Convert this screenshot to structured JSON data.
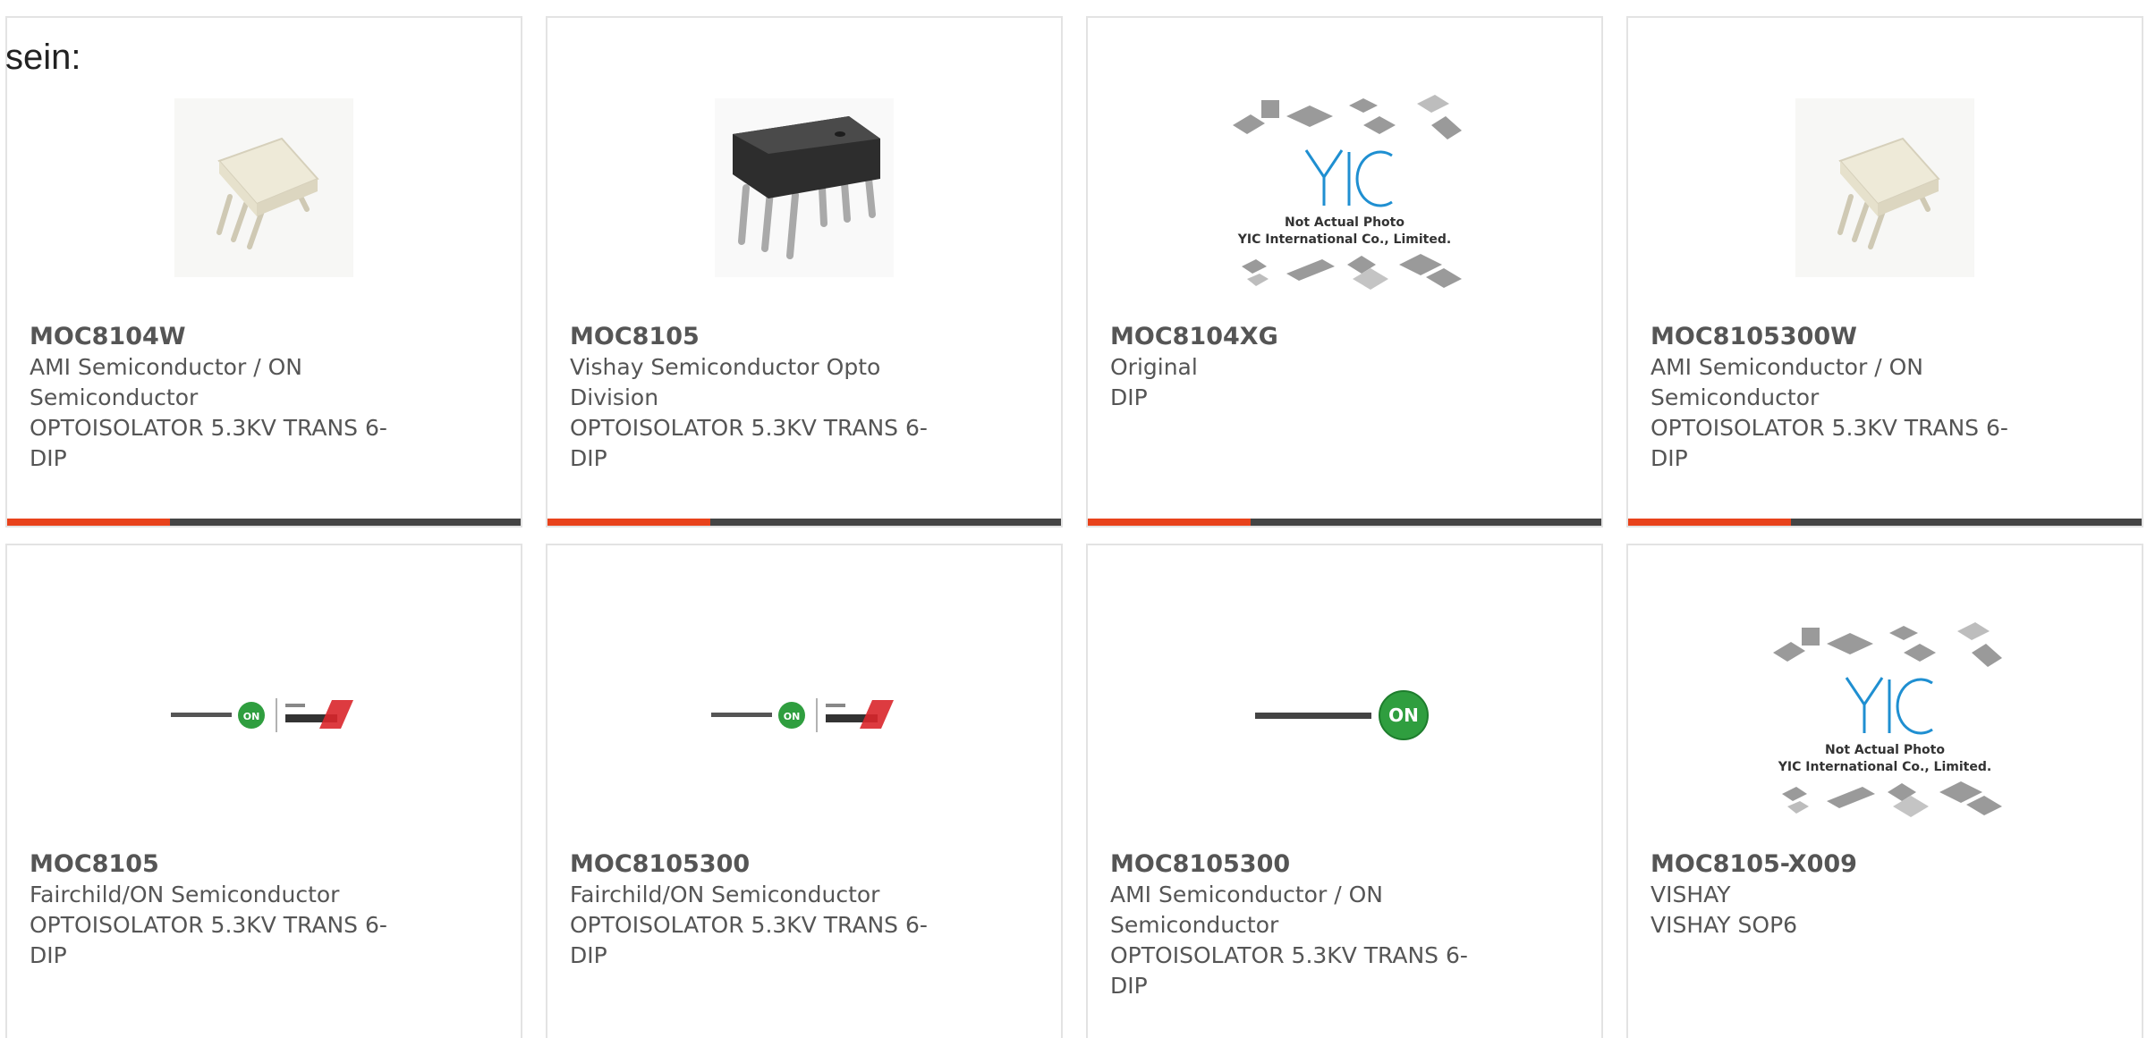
{
  "lead_text": "sein:",
  "colors": {
    "accent": "#e8421b",
    "bar": "#444444",
    "border": "#e3e3e3",
    "text": "#555555"
  },
  "cards": [
    {
      "part_number": "MOC8104W",
      "lines": [
        "AMI Semiconductor / ON",
        "Semiconductor",
        "OPTOISOLATOR 5.3KV TRANS 6-",
        "DIP"
      ],
      "image": "white-dip-optocoupler"
    },
    {
      "part_number": "MOC8105",
      "lines": [
        "Vishay Semiconductor Opto",
        "Division",
        "OPTOISOLATOR 5.3KV TRANS 6-",
        "DIP"
      ],
      "image": "black-dip-optocoupler"
    },
    {
      "part_number": "MOC8104XG",
      "lines": [
        "Original",
        "DIP"
      ],
      "image": "yic-placeholder",
      "placeholder_lines": [
        "Not Actual Photo",
        "YIC International Co., Limited."
      ]
    },
    {
      "part_number": "MOC8105300W",
      "lines": [
        "AMI Semiconductor / ON",
        "Semiconductor",
        "OPTOISOLATOR 5.3KV TRANS 6-",
        "DIP"
      ],
      "image": "white-dip-optocoupler"
    },
    {
      "part_number": "MOC8105",
      "lines": [
        "Fairchild/ON Semiconductor",
        "OPTOISOLATOR 5.3KV TRANS 6-",
        "DIP"
      ],
      "image": "on-fairchild-logo"
    },
    {
      "part_number": "MOC8105300",
      "lines": [
        "Fairchild/ON Semiconductor",
        "OPTOISOLATOR 5.3KV TRANS 6-",
        "DIP"
      ],
      "image": "on-fairchild-logo"
    },
    {
      "part_number": "MOC8105300",
      "lines": [
        "AMI Semiconductor / ON",
        "Semiconductor",
        "OPTOISOLATOR 5.3KV TRANS 6-",
        "DIP"
      ],
      "image": "on-semiconductor-logo"
    },
    {
      "part_number": "MOC8105-X009",
      "lines": [
        "VISHAY",
        "VISHAY SOP6"
      ],
      "image": "yic-placeholder",
      "placeholder_lines": [
        "Not Actual Photo",
        "YIC International Co., Limited."
      ]
    }
  ]
}
